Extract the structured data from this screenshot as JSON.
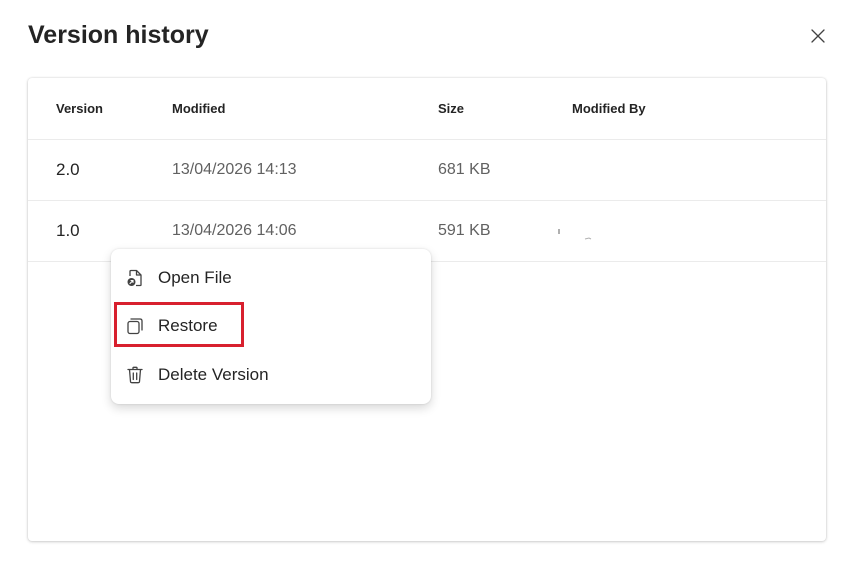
{
  "dialog": {
    "title": "Version history",
    "close_label": "Close"
  },
  "table": {
    "columns": [
      "Version",
      "Modified",
      "Size",
      "Modified By"
    ],
    "rows": [
      {
        "version": "2.0",
        "modified": "13/04/2026 14:13",
        "size": "681 KB",
        "modified_by": ""
      },
      {
        "version": "1.0",
        "modified": "13/04/2026 14:06",
        "size": "591 KB",
        "modified_by": ""
      }
    ]
  },
  "context_menu": {
    "items": [
      {
        "label": "Open File",
        "icon": "open-file-icon"
      },
      {
        "label": "Restore",
        "icon": "restore-icon"
      },
      {
        "label": "Delete Version",
        "icon": "trash-icon"
      }
    ]
  },
  "colors": {
    "highlight": "#d8202e",
    "text_primary": "#242424",
    "text_secondary": "#616161"
  }
}
